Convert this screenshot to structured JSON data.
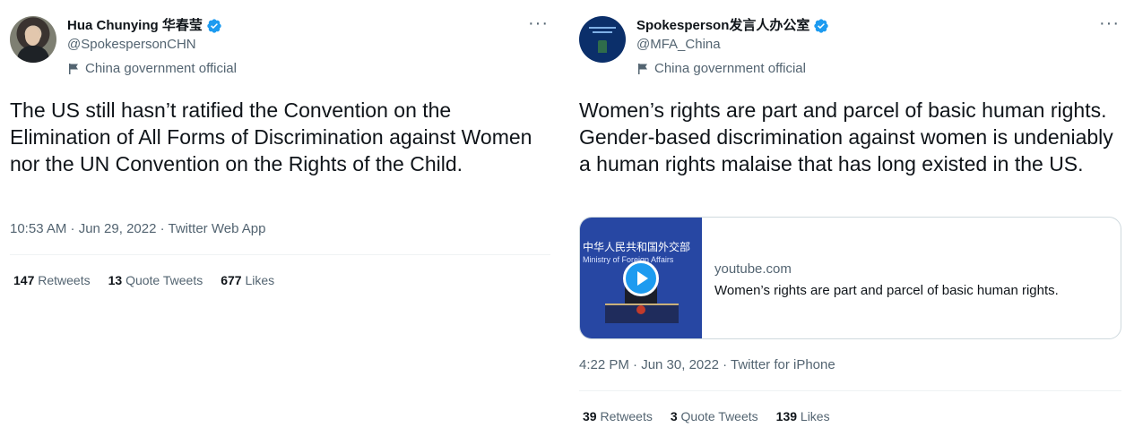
{
  "tweets": [
    {
      "display_name": "Hua Chunying 华春莹",
      "handle": "@SpokespersonCHN",
      "label": "China government official",
      "text": "The US still hasn’t ratified the Convention on the Elimination of All Forms of Discrimination against Women nor the UN Convention on the Rights of the Child.",
      "meta": "10:53 AM · Jun 29, 2022 · Twitter Web App",
      "more": "···",
      "stats": {
        "retweets_count": "147",
        "retweets_label": "Retweets",
        "quotes_count": "13",
        "quotes_label": "Quote Tweets",
        "likes_count": "677",
        "likes_label": "Likes"
      }
    },
    {
      "display_name": "Spokesperson发言人办公室",
      "handle": "@MFA_China",
      "label": "China government official",
      "text": "Women’s rights are part and parcel of basic human rights. Gender-based discrimination against women is undeniably a human rights malaise that has long existed in the US.",
      "meta": "4:22 PM · Jun 30, 2022 · Twitter for iPhone",
      "more": "···",
      "card": {
        "thumb_title": "中华人民共和国外交部",
        "thumb_subtitle": "Ministry of Foreign Affairs",
        "domain": "youtube.com",
        "title": "Women’s rights are part and parcel of basic human rights."
      },
      "stats": {
        "retweets_count": "39",
        "retweets_label": "Retweets",
        "quotes_count": "3",
        "quotes_label": "Quote Tweets",
        "likes_count": "139",
        "likes_label": "Likes"
      }
    }
  ],
  "icons": {
    "verified": "verified-badge-icon",
    "flag": "flag-icon",
    "more": "more-options-icon",
    "play": "play-icon"
  },
  "colors": {
    "verified_blue": "#1d9bf0",
    "secondary_text": "#536471",
    "primary_text": "#0f1419"
  }
}
